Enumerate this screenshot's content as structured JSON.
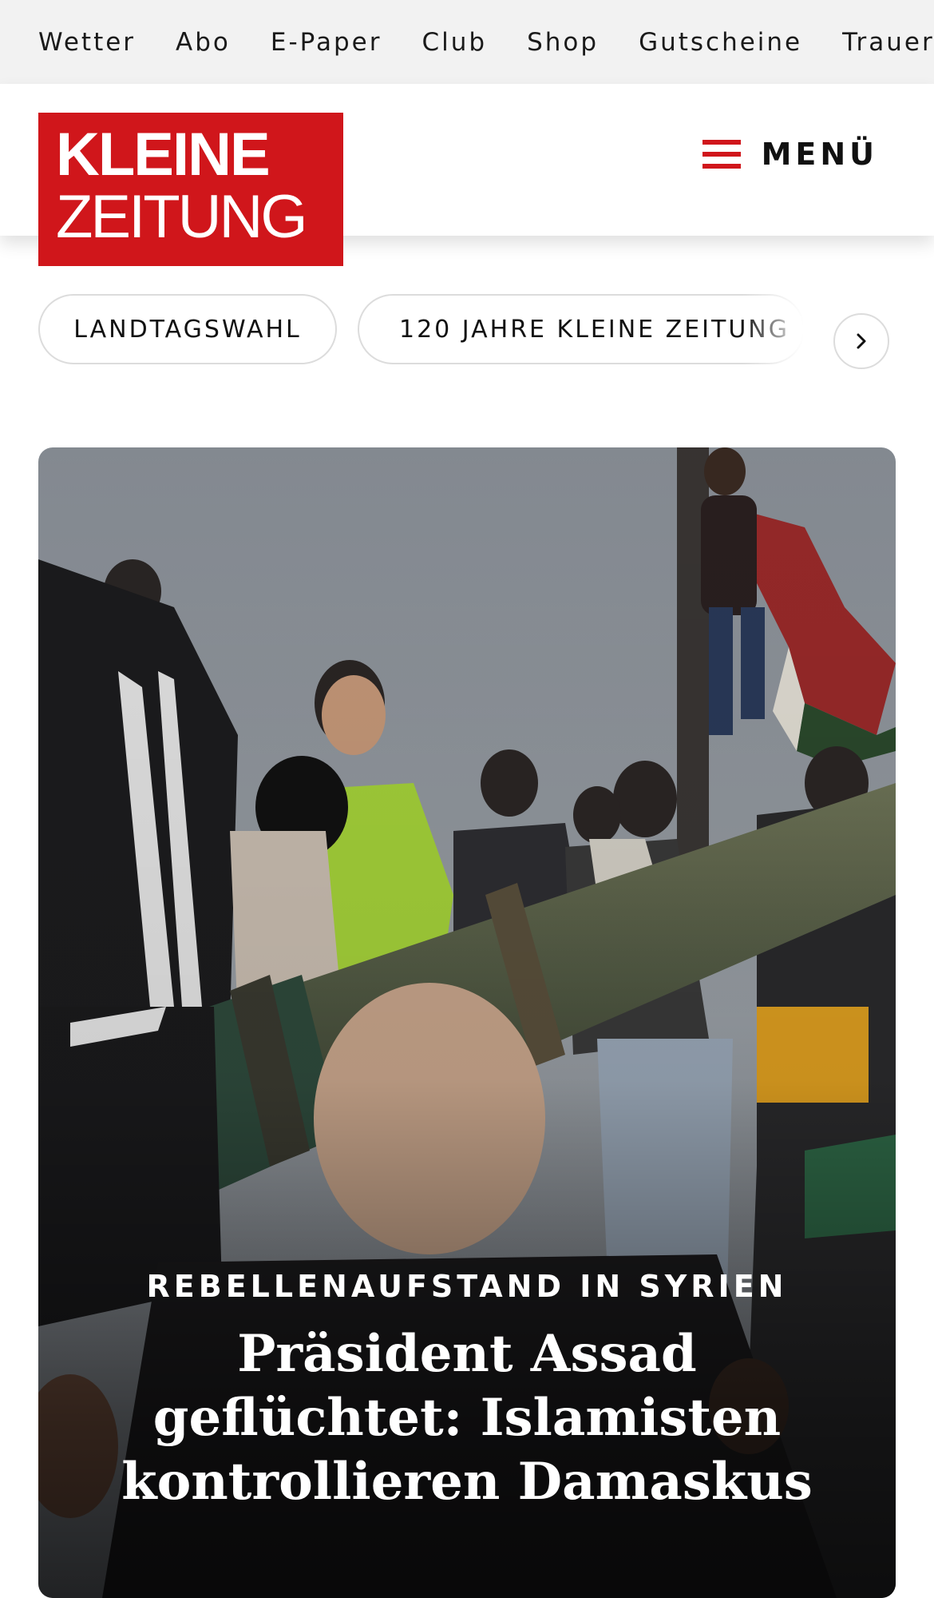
{
  "topnav": {
    "items": [
      "Wetter",
      "Abo",
      "E-Paper",
      "Club",
      "Shop",
      "Gutscheine",
      "Trauerportal"
    ]
  },
  "header": {
    "logo_line1": "KLEINE",
    "logo_line2": "ZEITUNG",
    "menu_label": "MENÜ"
  },
  "tags": {
    "items": [
      "LANDTAGSWAHL",
      "120 JAHRE KLEINE ZEITUNG"
    ],
    "next_icon": "chevron-right-icon"
  },
  "hero": {
    "kicker": "REBELLENAUFSTAND IN SYRIEN",
    "headline": "Präsident Assad geflüchtet: Islamisten kontrollieren Damaskus"
  },
  "colors": {
    "brand": "#d0161b",
    "topbar_bg": "#f2f2f2"
  }
}
